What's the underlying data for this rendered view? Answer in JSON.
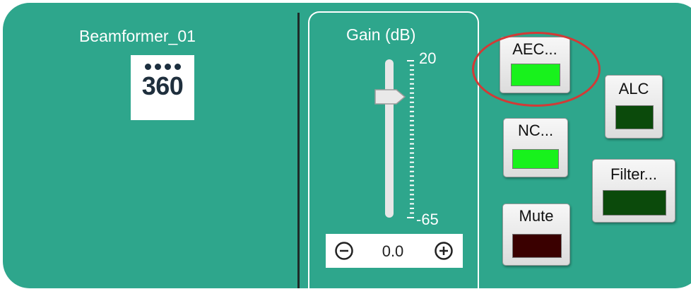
{
  "block": {
    "title": "Beamformer_01",
    "logo_text": "360",
    "logo_icon": "dots-360-icon"
  },
  "gain": {
    "title": "Gain  (dB)",
    "max_label": "20",
    "min_label": "-65",
    "value": "0.0",
    "slider_level_db": 0,
    "range_db": [
      -65,
      20
    ]
  },
  "buttons": {
    "aec": {
      "label": "AEC...",
      "state": "on",
      "led_color": "#18f21c"
    },
    "nc": {
      "label": "NC...",
      "state": "on",
      "led_color": "#18f21c"
    },
    "mute": {
      "label": "Mute",
      "state": "off",
      "led_color": "#3a0000"
    },
    "alc": {
      "label": "ALC",
      "state": "off",
      "led_color": "#0b4a0b"
    },
    "filter": {
      "label": "Filter...",
      "state": "off",
      "led_color": "#0b4a0b"
    }
  },
  "colors": {
    "panel": "#2ea68c",
    "highlight_ring": "#d23a36"
  }
}
